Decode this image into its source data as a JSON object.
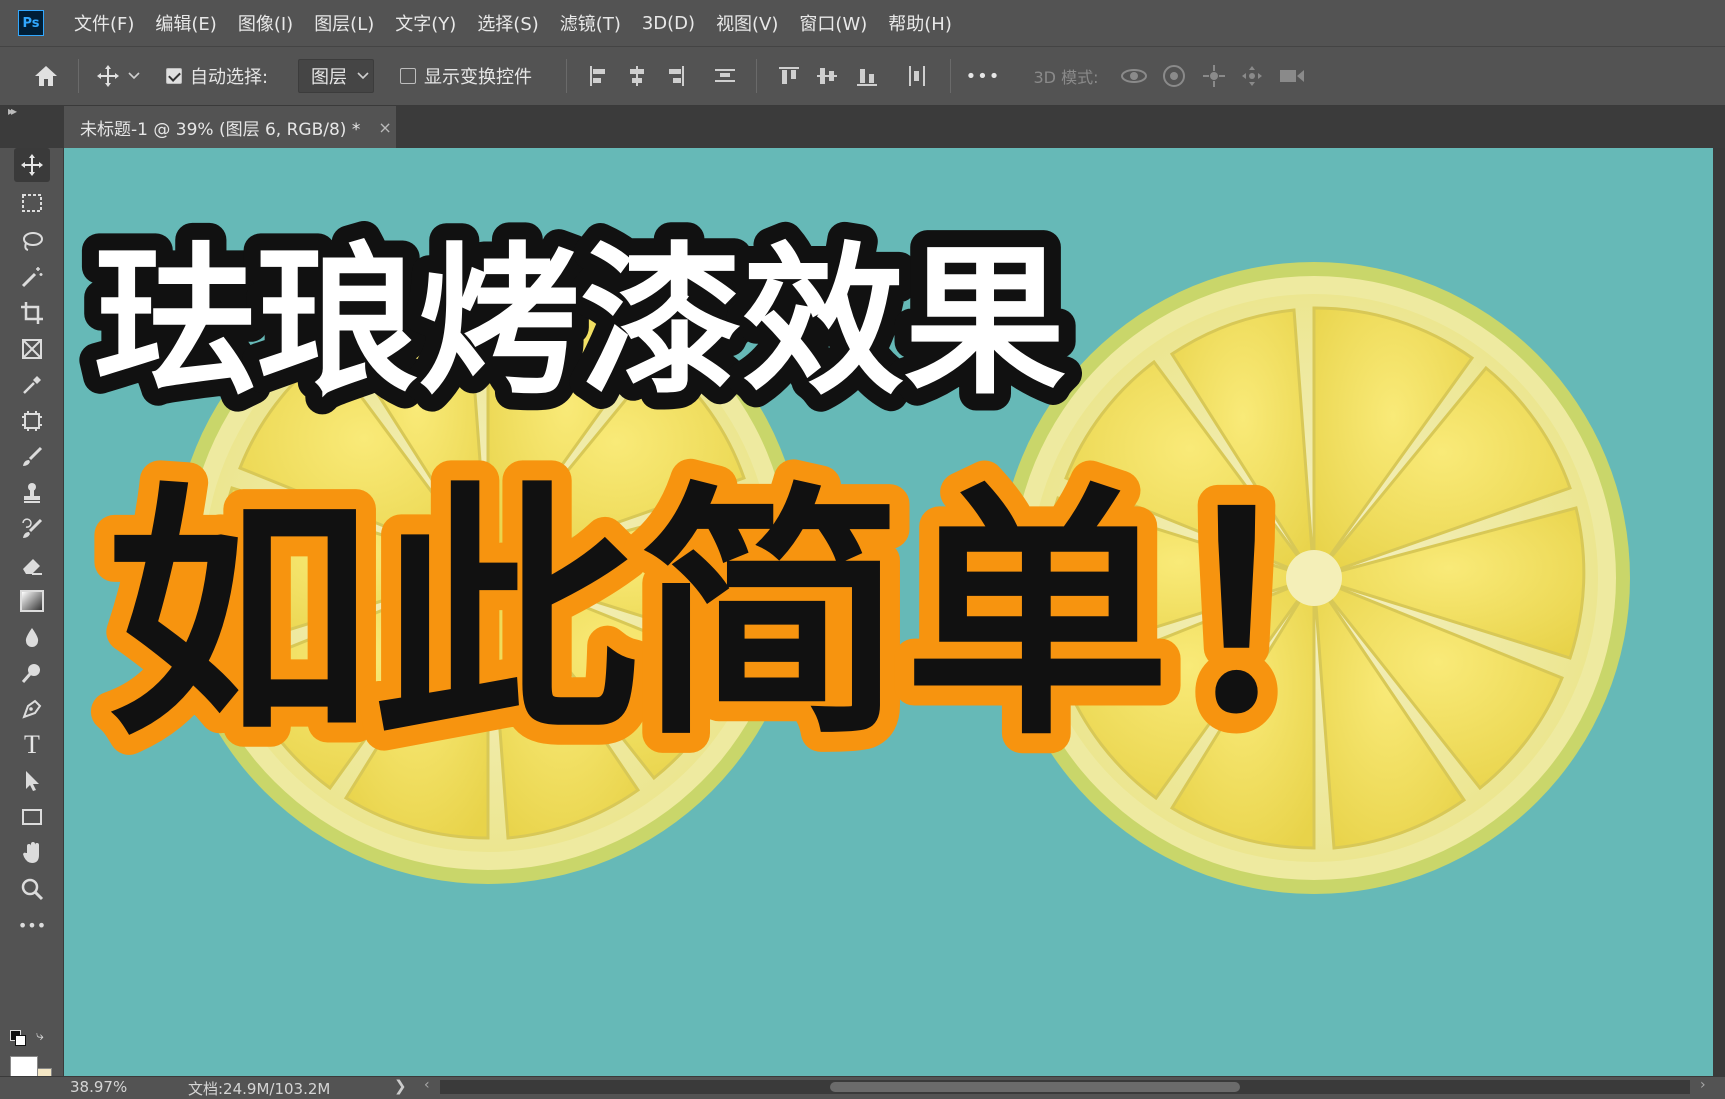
{
  "app": {
    "logo_text": "Ps"
  },
  "menu": [
    {
      "label": "文件(F)"
    },
    {
      "label": "编辑(E)"
    },
    {
      "label": "图像(I)"
    },
    {
      "label": "图层(L)"
    },
    {
      "label": "文字(Y)"
    },
    {
      "label": "选择(S)"
    },
    {
      "label": "滤镜(T)"
    },
    {
      "label": "3D(D)"
    },
    {
      "label": "视图(V)"
    },
    {
      "label": "窗口(W)"
    },
    {
      "label": "帮助(H)"
    }
  ],
  "options_bar": {
    "auto_select_label": "自动选择:",
    "auto_select_checked": true,
    "layer_select_value": "图层",
    "show_transform_label": "显示变换控件",
    "show_transform_checked": false,
    "more_label": "•••",
    "mode_3d_label": "3D 模式:"
  },
  "document_tab": {
    "title": "未标题-1 @ 39% (图层 6, RGB/8) *",
    "close_glyph": "×"
  },
  "canvas": {
    "background_color": "#66b9b7",
    "headline_line1": "珐琅烤漆效果",
    "headline_line2": "如此简单！",
    "stroke_color_line2": "#f7940f"
  },
  "toolbar": {
    "tools": [
      "move-tool-icon",
      "marquee-tool-icon",
      "lasso-tool-icon",
      "magic-wand-tool-icon",
      "crop-tool-icon",
      "frame-tool-icon",
      "eyedropper-tool-icon",
      "patch-tool-icon",
      "brush-tool-icon",
      "stamp-tool-icon",
      "history-brush-tool-icon",
      "eraser-tool-icon",
      "gradient-tool-icon",
      "blur-tool-icon",
      "dodge-tool-icon",
      "pen-tool-icon",
      "type-tool-icon",
      "path-select-tool-icon",
      "rectangle-tool-icon",
      "hand-tool-icon",
      "zoom-tool-icon",
      "more-tools-icon"
    ],
    "type_tool_glyph": "T",
    "more_glyph": "•••",
    "foreground_color": "#ffffff",
    "background_color": "#f3e6c4"
  },
  "status_bar": {
    "zoom": "38.97%",
    "doc_info": "文档:24.9M/103.2M",
    "arrow_glyph": "❯",
    "scroll_left_glyph": "‹",
    "scroll_right_glyph": "›"
  }
}
